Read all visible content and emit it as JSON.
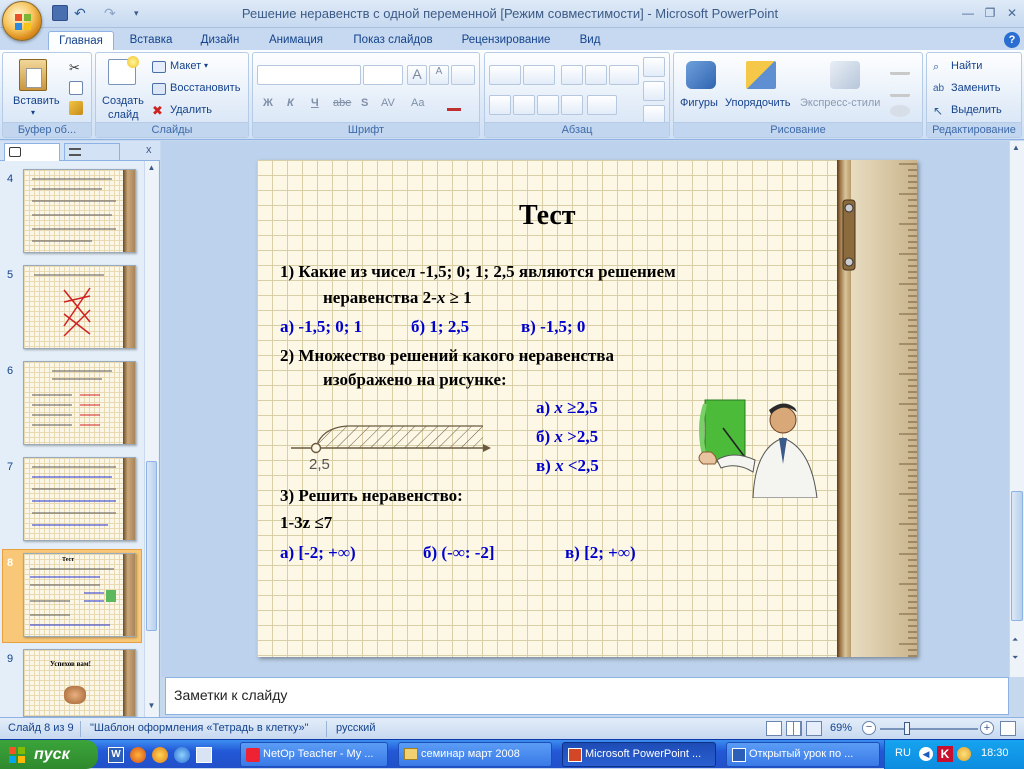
{
  "window": {
    "title": "Решение неравенств с одной переменной [Режим совместимости] - Microsoft PowerPoint",
    "help": "?"
  },
  "ribbon": {
    "tabs": [
      "Главная",
      "Вставка",
      "Дизайн",
      "Анимация",
      "Показ слайдов",
      "Рецензирование",
      "Вид"
    ],
    "active_tab": "Главная",
    "groups": {
      "clipboard": {
        "label": "Буфер об...",
        "paste": "Вставить"
      },
      "slides": {
        "label": "Слайды",
        "new_slide_1": "Создать",
        "new_slide_2": "слайд",
        "layout": "Макет",
        "reset": "Восстановить",
        "delete": "Удалить"
      },
      "font": {
        "label": "Шрифт",
        "bold": "Ж",
        "italic": "К",
        "underline": "Ч",
        "strike": "abe",
        "shadow": "S",
        "spacing": "AV",
        "case": "Aa",
        "grow": "A",
        "shrink": "A"
      },
      "paragraph": {
        "label": "Абзац"
      },
      "drawing": {
        "label": "Рисование",
        "shapes": "Фигуры",
        "arrange": "Упорядочить",
        "express_styles": "Экспресс-стили"
      },
      "editing": {
        "label": "Редактирование",
        "find": "Найти",
        "replace": "Заменить",
        "select": "Выделить"
      }
    }
  },
  "thumbnails": [
    {
      "num": "4",
      "title": ""
    },
    {
      "num": "5",
      "title": ""
    },
    {
      "num": "6",
      "title": ""
    },
    {
      "num": "7",
      "title": ""
    },
    {
      "num": "8",
      "title": "Тест"
    },
    {
      "num": "9",
      "title": "Успехов вам!"
    }
  ],
  "slide": {
    "title": "Тест",
    "q1_line1": "1) Какие из чисел -1,5; 0; 1; 2,5 являются решением",
    "q1_line2_prefix": "неравенства  2-",
    "q1_var": "x",
    "q1_line2_suffix": " ≥ 1",
    "q1_a": "а) -1,5; 0; 1",
    "q1_b": "б) 1; 2,5",
    "q1_c": "в) -1,5; 0",
    "q2_line1": "2) Множество решений какого неравенства",
    "q2_line2": "изображено на рисунке:",
    "q2_a_prefix": "а) ",
    "q2_a_var": "x",
    "q2_a_suffix": " ≥2,5",
    "q2_b_prefix": "б) ",
    "q2_b_var": "x",
    "q2_b_suffix": " >2,5",
    "q2_c_prefix": "в) ",
    "q2_c_var": "x",
    "q2_c_suffix": " <2,5",
    "number_line_label": "2,5",
    "q3_line1": "3) Решить неравенство:",
    "q3_line2": "1-3z ≤7",
    "q3_a": "а) [-2; +∞)",
    "q3_b": "б) (-∞: -2]",
    "q3_c": "в) [2; +∞)"
  },
  "notes_placeholder": "Заметки к слайду",
  "status": {
    "slide_of": "Слайд 8 из 9",
    "theme": "\"Шаблон оформления «Тетрадь в клетку»\"",
    "language": "русский",
    "zoom": "69%"
  },
  "taskbar": {
    "start": "пуск",
    "tasks": [
      "NetOp Teacher - My ...",
      "семинар март 2008",
      "Microsoft PowerPoint ...",
      "Открытый урок по ..."
    ],
    "active_task": 2,
    "lang": "RU",
    "clock": "18:30"
  },
  "colors": {
    "answer_blue": "#0000cc",
    "ribbon_text": "#15428b",
    "taskbar": "#2358d6"
  }
}
